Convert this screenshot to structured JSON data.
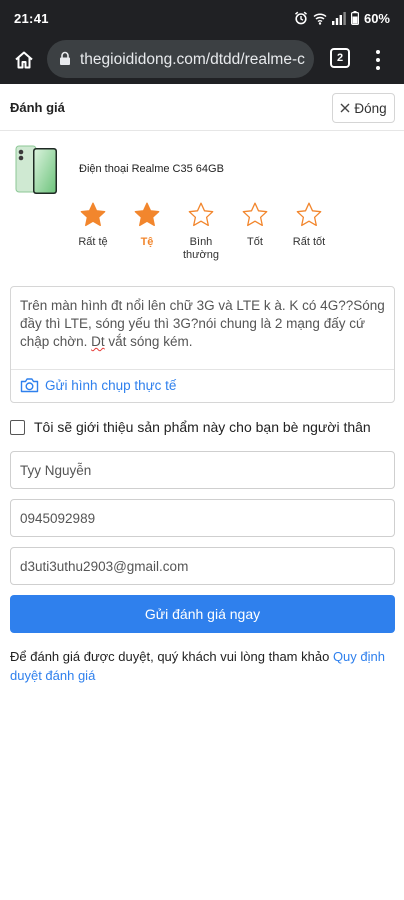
{
  "status_bar": {
    "time": "21:41",
    "battery": "60%",
    "icons": [
      "alarm-icon",
      "wifi-icon",
      "signal-icon",
      "battery-icon"
    ]
  },
  "browser": {
    "url": "thegioididong.com/dtdd/realme-c",
    "tab_count": "2",
    "icons": [
      "home-icon",
      "lock-icon",
      "tabs-icon",
      "more-vert-icon"
    ]
  },
  "header": {
    "title": "Đánh giá",
    "close_label": "Đóng"
  },
  "product": {
    "name": "Điện thoại Realme C35 64GB"
  },
  "rating": {
    "selected": 2,
    "max": 5,
    "filled_color": "#f2862d",
    "options": [
      {
        "label": "Rất tệ"
      },
      {
        "label": "Tệ"
      },
      {
        "label": "Bình thường"
      },
      {
        "label": "Tốt"
      },
      {
        "label": "Rất tốt"
      }
    ]
  },
  "review": {
    "text_part1": "Trên màn hình đt nổi lên chữ 3G và LTE k à. K có 4G??Sóng đầy thì LTE, sóng yếu thì 3G?nói chung là 2 mạng đấy cứ chập chờn. ",
    "text_underlined": "Dt",
    "text_part2": " vắt sóng kém.",
    "photo_button": "Gửi hình chụp thực tế"
  },
  "recommend": {
    "label": "Tôi sẽ giới thiệu sản phẩm này cho bạn bè người thân",
    "checked": false
  },
  "form": {
    "name_value": "Tyy Nguyễn",
    "phone_value": "0945092989",
    "email_value": "d3uti3uthu2903@gmail.com",
    "submit_label": "Gửi đánh giá ngay"
  },
  "note": {
    "text": "Để đánh giá được duyệt, quý khách vui lòng tham khảo ",
    "link": "Quy định duyệt đánh giá"
  },
  "colors": {
    "accent_blue": "#2f80ed",
    "star_orange": "#f2862d",
    "browser_dark": "#202124"
  }
}
